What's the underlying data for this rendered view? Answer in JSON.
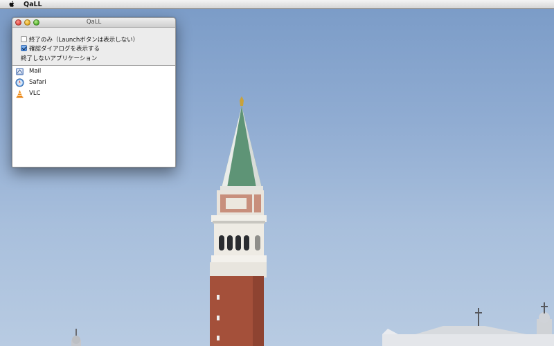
{
  "menubar": {
    "app_name": "QaLL"
  },
  "window": {
    "title": "QaLL",
    "options": [
      {
        "label": "終了のみ（Launchボタンは表示しない）",
        "checked": false
      },
      {
        "label": "確認ダイアログを表示する",
        "checked": true
      }
    ],
    "section_label": "終了しないアプリケーション",
    "apps": [
      {
        "name": "Mail",
        "icon": "mail-icon"
      },
      {
        "name": "Safari",
        "icon": "safari-icon"
      },
      {
        "name": "VLC",
        "icon": "vlc-icon"
      }
    ]
  },
  "colors": {
    "sky": "#90acd2",
    "tower_brick": "#a4503a",
    "spire_green": "#5e9476"
  }
}
